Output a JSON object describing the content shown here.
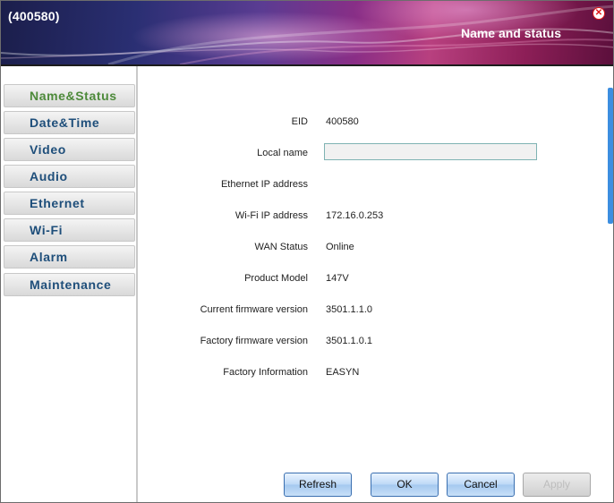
{
  "window": {
    "title": "(400580)",
    "section_title": "Name and status",
    "close_icon": "close-icon"
  },
  "sidebar": {
    "items": [
      {
        "label": "Name&Status",
        "active": true
      },
      {
        "label": "Date&Time",
        "active": false
      },
      {
        "label": "Video",
        "active": false
      },
      {
        "label": "Audio",
        "active": false
      },
      {
        "label": "Ethernet",
        "active": false
      },
      {
        "label": "Wi-Fi",
        "active": false
      },
      {
        "label": "Alarm",
        "active": false
      },
      {
        "label": "Maintenance",
        "active": false
      }
    ]
  },
  "fields": {
    "eid": {
      "label": "EID",
      "value": "400580"
    },
    "local_name": {
      "label": "Local name",
      "value": ""
    },
    "ethernet_ip": {
      "label": "Ethernet IP address",
      "value": ""
    },
    "wifi_ip": {
      "label": "Wi-Fi IP address",
      "value": "172.16.0.253"
    },
    "wan_status": {
      "label": "WAN Status",
      "value": "Online"
    },
    "product_model": {
      "label": "Product Model",
      "value": "147V"
    },
    "current_fw": {
      "label": "Current firmware version",
      "value": "3501.1.1.0"
    },
    "factory_fw": {
      "label": "Factory firmware version",
      "value": "3501.1.0.1"
    },
    "factory_info": {
      "label": "Factory Information",
      "value": "EASYN"
    }
  },
  "buttons": {
    "refresh": "Refresh",
    "ok": "OK",
    "cancel": "Cancel",
    "apply": "Apply"
  },
  "colors": {
    "active_nav": "#4d8a3a",
    "nav_text": "#1e4e7a",
    "close": "#e01818",
    "button_border": "#3a6fb0"
  }
}
